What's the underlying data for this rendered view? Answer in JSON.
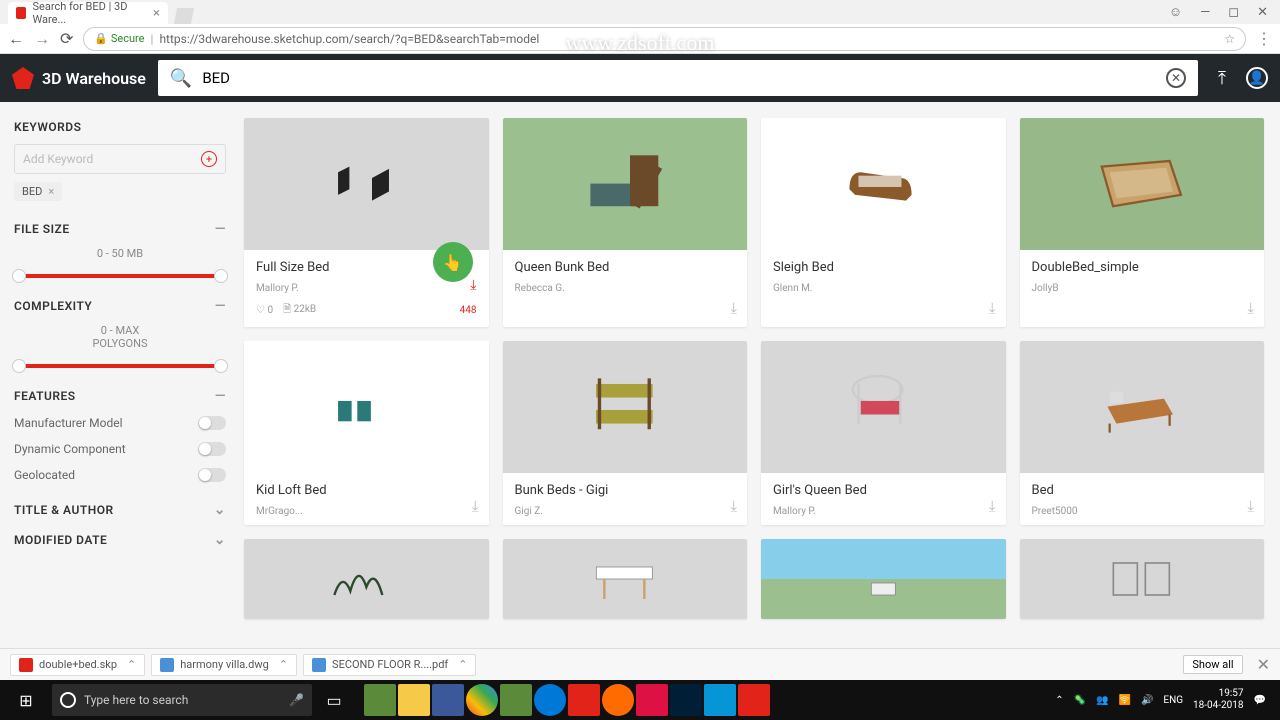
{
  "browser": {
    "tab_title": "Search for BED | 3D Ware...",
    "url_secure": "Secure",
    "url": "https://3dwarehouse.sketchup.com/search/?q=BED&searchTab=model"
  },
  "header": {
    "brand": "3D Warehouse",
    "search_value": "BED"
  },
  "sidebar": {
    "keywords_title": "KEYWORDS",
    "keyword_placeholder": "Add Keyword",
    "keyword_chip": "BED",
    "filesize_title": "FILE SIZE",
    "filesize_range": "0 - 50 MB",
    "complexity_title": "COMPLEXITY",
    "complexity_range1": "0 - MAX",
    "complexity_range2": "POLYGONS",
    "features_title": "FEATURES",
    "feat1": "Manufacturer Model",
    "feat2": "Dynamic Component",
    "feat3": "Geolocated",
    "title_author": "TITLE & AUTHOR",
    "modified_date": "MODIFIED DATE"
  },
  "results": [
    {
      "title": "Full Size Bed",
      "author": "Mallory P.",
      "likes": "0",
      "size": "22kB",
      "downloads": "448",
      "bg": "#d7d7d7",
      "featured": true
    },
    {
      "title": "Queen Bunk Bed",
      "author": "Rebecca G.",
      "bg": "#9bbf8e"
    },
    {
      "title": "Sleigh Bed",
      "author": "Glenn M.",
      "bg": "#ffffff"
    },
    {
      "title": "DoubleBed_simple",
      "author": "JollyB",
      "bg": "#97b98a"
    },
    {
      "title": "Kid Loft Bed",
      "author": "MrGrago...",
      "bg": "#ffffff"
    },
    {
      "title": "Bunk Beds - Gigi",
      "author": "Gigi Z.",
      "bg": "#d7d7d7"
    },
    {
      "title": "Girl's Queen Bed",
      "author": "Mallory P.",
      "bg": "#d7d7d7"
    },
    {
      "title": "Bed",
      "author": "Preet5000",
      "bg": "#d7d7d7"
    }
  ],
  "downloads": {
    "item1": "double+bed.skp",
    "item2": "harmony villa.dwg",
    "item3": "SECOND FLOOR R....pdf",
    "show_all": "Show all"
  },
  "taskbar": {
    "search_placeholder": "Type here to search",
    "lang": "ENG",
    "time": "19:57",
    "date": "18-04-2018"
  },
  "watermark": "www.zdsoft.com"
}
